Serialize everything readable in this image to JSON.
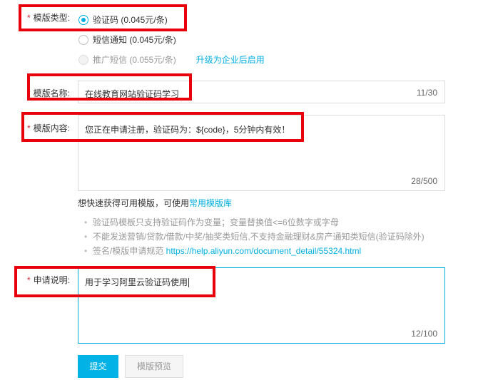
{
  "template_type": {
    "required_mark": "*",
    "label": "模版类型:",
    "options": [
      {
        "label": "验证码 (0.045元/条)",
        "state": "checked"
      },
      {
        "label": "短信通知 (0.045元/条)",
        "state": "unchecked"
      },
      {
        "label": "推广短信 (0.055元/条)",
        "state": "disabled"
      }
    ],
    "upgrade_link": "升级为企业后启用"
  },
  "template_name": {
    "required_mark": "*",
    "label": "模版名称:",
    "value": "在线教育网站验证码学习",
    "counter": "11/30"
  },
  "template_content": {
    "required_mark": "*",
    "label": "模版内容:",
    "value": "您正在申请注册，验证码为：${code}，5分钟内有效！",
    "counter": "28/500"
  },
  "quick_tip": {
    "text": "想快速获得可用模版，可使用",
    "link": "常用模版库"
  },
  "rules": [
    {
      "text": "验证码模板只支持验证码作为变量；变量替换值<=6位数字或字母"
    },
    {
      "text": "不能发送营销/贷款/借款/中奖/抽奖类短信,不支持金融理财&房产通知类短信(验证码除外)"
    },
    {
      "text": "签名/模版申请规范 ",
      "link": "https://help.aliyun.com/document_detail/55324.html"
    }
  ],
  "application_note": {
    "required_mark": "*",
    "label": "申请说明:",
    "value": "用于学习阿里云验证码使用",
    "counter": "12/100"
  },
  "buttons": {
    "submit": "提交",
    "preview": "模版预览"
  },
  "colors": {
    "accent": "#00aee0",
    "highlight_box": "#e8000b",
    "required": "#e0262d"
  }
}
